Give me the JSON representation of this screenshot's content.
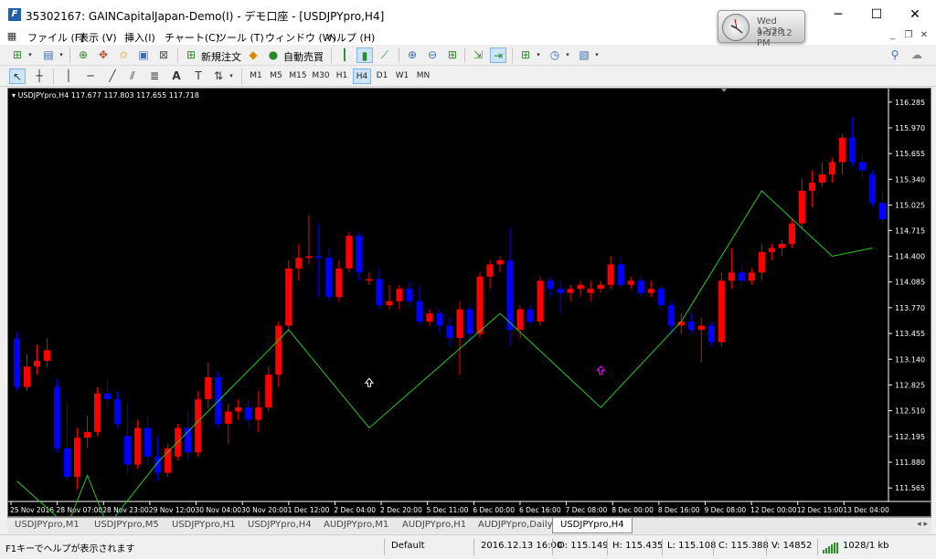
{
  "window": {
    "title": "35302167: GAINCapitalJapan-Demo(I) - デモ口座 - [USDJPYpro,H4]",
    "app_icon": "F",
    "controls": {
      "minimize": "─",
      "maximize": "☐",
      "close": "✕"
    }
  },
  "clock": {
    "date": "Wed 12/28",
    "time": "9:52:12 PM"
  },
  "menu": [
    "ファイル (F)",
    "表示 (V)",
    "挿入(I)",
    "チャート(C)",
    "ツール (T)",
    "ウィンドウ (W)",
    "ヘルプ (H)"
  ],
  "mdi": {
    "minimize": "_",
    "restore": "❐",
    "close": "✕"
  },
  "toolbar": {
    "new_order": "新規注文",
    "auto_trading": "自動売買"
  },
  "timeframes": [
    "M1",
    "M5",
    "M15",
    "M30",
    "H1",
    "H4",
    "D1",
    "W1",
    "MN"
  ],
  "active_timeframe": "H4",
  "chart": {
    "info": "USDJPYpro,H4  117.677 117.803 117.655 117.718",
    "up_color": "#ff0000",
    "down_color": "#0000ff",
    "zigzag_color": "#22cc22"
  },
  "tabs": [
    "USDJPYpro,M1",
    "USDJPYpro,M5",
    "USDJPYpro,H1",
    "USDJPYpro,H4",
    "AUDJPYpro,M1",
    "AUDJPYpro,H1",
    "AUDJPYpro,Daily",
    "USDJPYpro,H4"
  ],
  "active_tab_index": 7,
  "status": {
    "help": "F1キーでヘルプが表示されます",
    "profile": "Default",
    "datetime": "2016.12.13 16:00",
    "open": "O: 115.149",
    "high": "H: 115.435",
    "low": "L: 115.108",
    "close": "C: 115.388",
    "volume": "V: 14852",
    "traffic": "1028/1 kb"
  },
  "chart_data": {
    "type": "candlestick",
    "title": "",
    "symbol": "USDJPYpro",
    "timeframe": "H4",
    "ylim": [
      111.4,
      116.45
    ],
    "y_ticks": [
      "116.285",
      "115.970",
      "115.655",
      "115.340",
      "115.025",
      "114.715",
      "114.400",
      "114.085",
      "113.770",
      "113.455",
      "113.140",
      "112.825",
      "112.510",
      "112.195",
      "111.880",
      "111.565"
    ],
    "x_ticks": [
      "25 Nov 2016",
      "28 Nov 07:00",
      "28 Nov 23:00",
      "29 Nov 12:00",
      "30 Nov 04:00",
      "30 Nov 20:00",
      "1 Dec 12:00",
      "2 Dec 04:00",
      "2 Dec 20:00",
      "5 Dec 11:00",
      "6 Dec 00:00",
      "6 Dec 16:00",
      "7 Dec 08:00",
      "8 Dec 00:00",
      "8 Dec 16:00",
      "9 Dec 08:00",
      "12 Dec 00:00",
      "12 Dec 15:00",
      "13 Dec 04:00"
    ],
    "candles": [
      [
        113.39,
        113.47,
        112.76,
        112.8
      ],
      [
        112.8,
        113.2,
        112.75,
        113.05
      ],
      [
        113.05,
        113.32,
        112.95,
        113.12
      ],
      [
        113.12,
        113.4,
        113.05,
        113.25
      ],
      [
        112.8,
        112.9,
        112.0,
        112.05
      ],
      [
        112.05,
        112.6,
        111.65,
        111.7
      ],
      [
        111.7,
        112.3,
        111.55,
        112.18
      ],
      [
        112.18,
        112.45,
        112.05,
        112.25
      ],
      [
        112.25,
        112.8,
        112.2,
        112.72
      ],
      [
        112.72,
        112.9,
        112.55,
        112.65
      ],
      [
        112.65,
        112.75,
        112.3,
        112.35
      ],
      [
        112.2,
        112.6,
        111.75,
        111.85
      ],
      [
        111.85,
        112.4,
        111.8,
        112.3
      ],
      [
        112.3,
        112.45,
        111.85,
        111.95
      ],
      [
        111.95,
        112.2,
        111.65,
        111.75
      ],
      [
        111.75,
        112.1,
        111.7,
        112.05
      ],
      [
        111.95,
        112.35,
        111.9,
        112.3
      ],
      [
        112.3,
        112.5,
        111.9,
        112.0
      ],
      [
        112.0,
        112.75,
        111.95,
        112.65
      ],
      [
        112.65,
        113.1,
        112.55,
        112.92
      ],
      [
        112.92,
        113.0,
        112.3,
        112.35
      ],
      [
        112.35,
        112.6,
        112.1,
        112.5
      ],
      [
        112.5,
        112.65,
        112.4,
        112.55
      ],
      [
        112.55,
        112.65,
        112.3,
        112.4
      ],
      [
        112.4,
        112.75,
        112.25,
        112.55
      ],
      [
        112.55,
        113.05,
        112.5,
        112.95
      ],
      [
        112.95,
        113.6,
        112.8,
        113.55
      ],
      [
        113.55,
        114.35,
        113.5,
        114.25
      ],
      [
        114.25,
        114.55,
        114.1,
        114.38
      ],
      [
        114.38,
        114.9,
        114.3,
        114.4
      ],
      [
        114.4,
        114.8,
        113.9,
        114.38
      ],
      [
        114.38,
        114.5,
        113.85,
        113.9
      ],
      [
        113.9,
        114.35,
        113.85,
        114.25
      ],
      [
        114.25,
        114.7,
        114.2,
        114.65
      ],
      [
        114.65,
        114.7,
        114.1,
        114.2
      ],
      [
        114.1,
        114.2,
        114.05,
        114.12
      ],
      [
        114.12,
        114.25,
        113.75,
        113.8
      ],
      [
        113.8,
        114.05,
        113.75,
        113.85
      ],
      [
        113.85,
        114.05,
        113.75,
        114.0
      ],
      [
        114.0,
        114.1,
        113.8,
        113.85
      ],
      [
        113.85,
        114.05,
        113.55,
        113.6
      ],
      [
        113.6,
        113.75,
        113.55,
        113.7
      ],
      [
        113.7,
        113.75,
        113.45,
        113.55
      ],
      [
        113.55,
        113.65,
        113.3,
        113.4
      ],
      [
        113.4,
        113.85,
        112.95,
        113.75
      ],
      [
        113.75,
        113.8,
        113.35,
        113.45
      ],
      [
        113.45,
        114.2,
        113.4,
        114.15
      ],
      [
        114.15,
        114.35,
        114.0,
        114.3
      ],
      [
        114.3,
        114.4,
        114.2,
        114.35
      ],
      [
        114.35,
        114.75,
        113.3,
        113.5
      ],
      [
        113.5,
        113.8,
        113.4,
        113.75
      ],
      [
        113.75,
        113.8,
        113.55,
        113.6
      ],
      [
        113.6,
        114.15,
        113.55,
        114.1
      ],
      [
        114.1,
        114.15,
        113.9,
        114.0
      ],
      [
        114.0,
        114.1,
        113.7,
        113.95
      ],
      [
        113.95,
        114.05,
        113.85,
        114.0
      ],
      [
        114.0,
        114.1,
        113.9,
        114.05
      ],
      [
        113.95,
        114.1,
        113.85,
        114.0
      ],
      [
        114.0,
        114.1,
        113.95,
        114.05
      ],
      [
        114.05,
        114.4,
        114.0,
        114.3
      ],
      [
        114.3,
        114.4,
        114.0,
        114.05
      ],
      [
        114.05,
        114.15,
        114.0,
        114.1
      ],
      [
        114.1,
        114.15,
        113.9,
        113.95
      ],
      [
        113.95,
        114.1,
        113.9,
        114.0
      ],
      [
        114.0,
        114.05,
        113.75,
        113.8
      ],
      [
        113.8,
        113.85,
        113.45,
        113.55
      ],
      [
        113.55,
        113.7,
        113.45,
        113.6
      ],
      [
        113.6,
        113.7,
        113.45,
        113.5
      ],
      [
        113.5,
        113.65,
        113.1,
        113.55
      ],
      [
        113.55,
        113.6,
        113.3,
        113.35
      ],
      [
        113.35,
        114.2,
        113.3,
        114.1
      ],
      [
        114.1,
        114.5,
        114.0,
        114.2
      ],
      [
        114.2,
        114.3,
        114.05,
        114.1
      ],
      [
        114.1,
        114.25,
        114.05,
        114.2
      ],
      [
        114.2,
        114.55,
        114.1,
        114.45
      ],
      [
        114.45,
        114.55,
        114.35,
        114.5
      ],
      [
        114.5,
        114.6,
        114.4,
        114.55
      ],
      [
        114.55,
        114.85,
        114.5,
        114.8
      ],
      [
        114.8,
        115.35,
        114.75,
        115.2
      ],
      [
        115.2,
        115.45,
        115.0,
        115.3
      ],
      [
        115.3,
        115.55,
        115.25,
        115.4
      ],
      [
        115.4,
        115.6,
        115.3,
        115.55
      ],
      [
        115.55,
        115.9,
        115.4,
        115.85
      ],
      [
        115.85,
        116.1,
        115.5,
        115.55
      ],
      [
        115.55,
        115.65,
        115.35,
        115.45
      ],
      [
        115.4,
        115.45,
        115.0,
        115.05
      ],
      [
        115.05,
        115.2,
        114.8,
        114.85
      ]
    ],
    "zigzag": [
      {
        "x": 0,
        "y": 111.65
      },
      {
        "x": 5,
        "y": 111.1
      },
      {
        "x": 7,
        "y": 111.72
      },
      {
        "x": 9,
        "y": 111.1
      },
      {
        "x": 14,
        "y": 111.88
      },
      {
        "x": 27,
        "y": 113.5
      },
      {
        "x": 35,
        "y": 112.3
      },
      {
        "x": 48,
        "y": 113.7
      },
      {
        "x": 58,
        "y": 112.55
      },
      {
        "x": 66,
        "y": 113.6
      },
      {
        "x": 74,
        "y": 115.2
      },
      {
        "x": 81,
        "y": 114.4
      },
      {
        "x": 85,
        "y": 114.5
      }
    ],
    "signals": [
      {
        "index": 35,
        "price": 112.85,
        "type": "up",
        "color": "#ffffff"
      },
      {
        "index": 58,
        "price": 113.0,
        "type": "up",
        "color": "#ff00ff"
      }
    ]
  }
}
